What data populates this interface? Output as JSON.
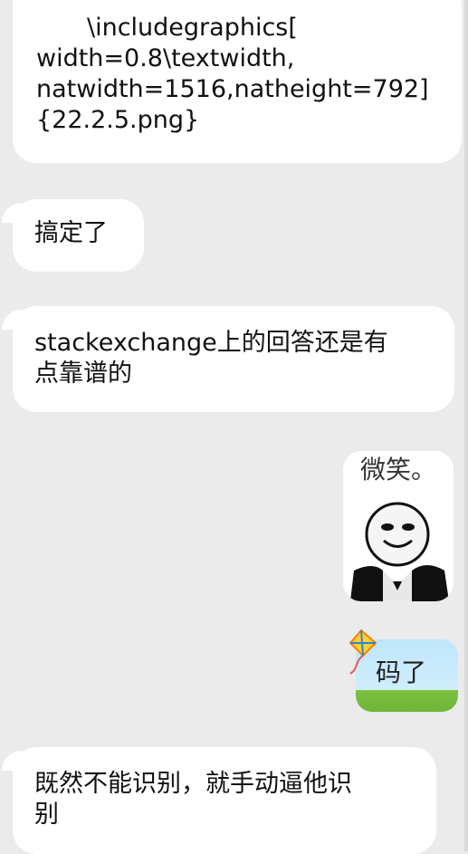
{
  "messages": [
    {
      "id": "m1",
      "side": "left",
      "text": "\\includegraphics[\nwidth=0.8\\textwidth,\nnatwidth=1516,natheight=792]\n{22.2.5.png}"
    },
    {
      "id": "m2",
      "side": "left",
      "text": "搞定了"
    },
    {
      "id": "m3",
      "side": "left",
      "text": "stackexchange上的回答还是有\n点靠谱的"
    },
    {
      "id": "m4",
      "side": "right",
      "type": "sticker",
      "caption": "微笑。"
    },
    {
      "id": "m5",
      "side": "right",
      "type": "kite-bubble",
      "text": "码了"
    },
    {
      "id": "m6",
      "side": "left",
      "text": "既然不能识别，就手动逼他识\n别"
    }
  ],
  "colors": {
    "background": "#ebebeb",
    "bubble": "#ffffff",
    "text": "#111111",
    "kite_sky": "#cfeefc",
    "kite_grass": "#7dc142"
  },
  "icons": {
    "sticker": "meme-face-sticker",
    "kite": "kite-icon"
  }
}
